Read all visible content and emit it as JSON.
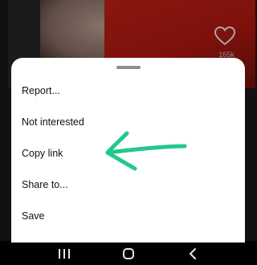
{
  "video": {
    "like_count": "165k",
    "accent_red": "#c21a12"
  },
  "sheet": {
    "items": [
      {
        "label": "Report..."
      },
      {
        "label": "Not interested"
      },
      {
        "label": "Copy link"
      },
      {
        "label": "Share to..."
      },
      {
        "label": "Save"
      }
    ]
  },
  "annotation": {
    "icon": "hand-drawn-arrow",
    "color": "#22c98a",
    "points_to": "Copy link"
  },
  "nav": {
    "buttons": [
      {
        "icon": "recent-apps-icon"
      },
      {
        "icon": "home-icon"
      },
      {
        "icon": "back-icon"
      }
    ]
  }
}
